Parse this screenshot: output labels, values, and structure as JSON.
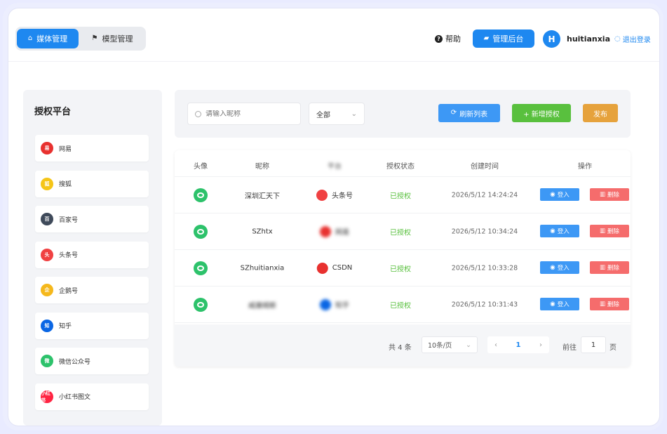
{
  "header": {
    "tabs": [
      {
        "label": "媒体管理",
        "icon": "home-icon",
        "active": true
      },
      {
        "label": "模型管理",
        "icon": "flag-icon",
        "active": false
      }
    ],
    "help_label": "帮助",
    "admin_label": "管理后台",
    "avatar_initial": "H",
    "username": "huitianxia",
    "logout_label": "退出登录"
  },
  "sidebar": {
    "title": "授权平台",
    "items": [
      {
        "label": "网易",
        "color": "#e8312f",
        "glyph": "易"
      },
      {
        "label": "搜狐",
        "color": "#f5c518",
        "glyph": "狐"
      },
      {
        "label": "百家号",
        "color": "#3f4a5a",
        "glyph": "百"
      },
      {
        "label": "头条号",
        "color": "#f04142",
        "glyph": "头"
      },
      {
        "label": "企鹅号",
        "color": "#f5b81c",
        "glyph": "企"
      },
      {
        "label": "知乎",
        "color": "#0a66e4",
        "glyph": "知"
      },
      {
        "label": "微信公众号",
        "color": "#2dc26b",
        "glyph": "微"
      },
      {
        "label": "小红书图文",
        "color": "#ff2442",
        "glyph": "小红书"
      }
    ]
  },
  "toolbar": {
    "search_placeholder": "请输入昵称",
    "filter_value": "全部",
    "refresh_label": "刷新列表",
    "add_label": "+ 新增授权",
    "publish_label": "发布"
  },
  "table": {
    "columns": [
      "头像",
      "昵称",
      "平台",
      "授权状态",
      "创建时间",
      "操作"
    ],
    "rows": [
      {
        "nickname": "深圳汇天下",
        "platform": "头条号",
        "platform_color": "#f04142",
        "status": "已授权",
        "created": "2026/5/12 14:24:24"
      },
      {
        "nickname": "SZhtx",
        "platform": "网易",
        "platform_color": "#e8312f",
        "status": "已授权",
        "created": "2026/5/12 10:34:24"
      },
      {
        "nickname": "SZhuitianxia",
        "platform": "CSDN",
        "platform_color": "#e8312f",
        "status": "已授权",
        "created": "2026/5/12 10:33:28"
      },
      {
        "nickname": "威廉姆斯",
        "platform": "知乎",
        "platform_color": "#0a66e4",
        "status": "已授权",
        "created": "2026/5/12 10:31:43"
      }
    ],
    "login_label": "登入",
    "delete_label": "删除"
  },
  "pagination": {
    "total_text": "共 4 条",
    "page_size": "10条/页",
    "current_page": "1",
    "goto_label": "前往",
    "goto_value": "1",
    "page_suffix": "页"
  },
  "colors": {
    "primary": "#1e88f0",
    "success": "#59c03e",
    "warning": "#e6a23c",
    "danger": "#f56c6c"
  }
}
